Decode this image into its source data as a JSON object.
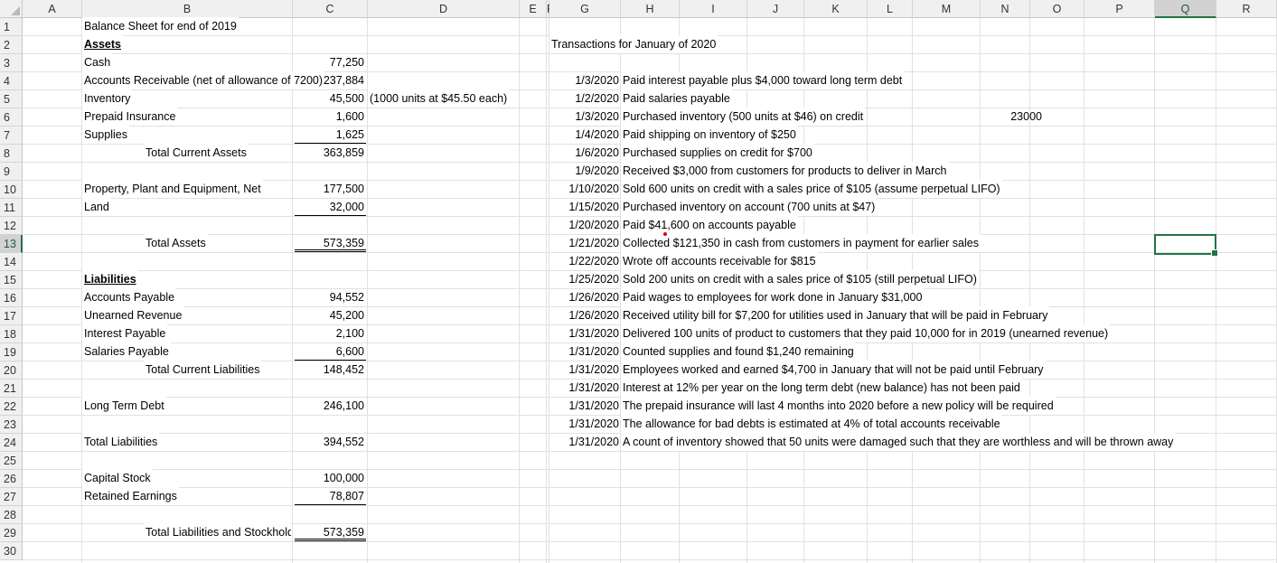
{
  "columns": [
    "A",
    "B",
    "C",
    "D",
    "E",
    "F",
    "G",
    "H",
    "I",
    "J",
    "K",
    "L",
    "M",
    "N",
    "O",
    "P",
    "Q",
    "R"
  ],
  "rows": [
    "1",
    "2",
    "3",
    "4",
    "5",
    "6",
    "7",
    "8",
    "9",
    "10",
    "11",
    "12",
    "13",
    "14",
    "15",
    "16",
    "17",
    "18",
    "19",
    "20",
    "21",
    "22",
    "23",
    "24",
    "25",
    "26",
    "27",
    "28",
    "29",
    "30"
  ],
  "balance": {
    "title": "Balance Sheet for end of 2019",
    "assets_header": "Assets",
    "cash_label": "Cash",
    "cash_value": "77,250",
    "ar_label": "Accounts Receivable (net of allowance of 7200)",
    "ar_value": "237,884",
    "inventory_label": "Inventory",
    "inventory_value": "45,500",
    "inventory_note": "(1000 units at $45.50 each)",
    "prepaid_label": "Prepaid Insurance",
    "prepaid_value": "1,600",
    "supplies_label": "Supplies",
    "supplies_value": "1,625",
    "tca_label": "Total Current Assets",
    "tca_value": "363,859",
    "ppe_label": "Property, Plant and Equipment, Net",
    "ppe_value": "177,500",
    "land_label": "Land",
    "land_value": "32,000",
    "ta_label": "Total Assets",
    "ta_value": "573,359",
    "liabilities_header": "Liabilities",
    "ap_label": "Accounts Payable",
    "ap_value": "94,552",
    "unearned_label": "Unearned Revenue",
    "unearned_value": "45,200",
    "interest_label": "Interest Payable",
    "interest_value": "2,100",
    "salaries_label": "Salaries Payable",
    "salaries_value": "6,600",
    "tcl_label": "Total Current Liabilities",
    "tcl_value": "148,452",
    "ltd_label": "Long Term Debt",
    "ltd_value": "246,100",
    "tl_label": "Total Liabilities",
    "tl_value": "394,552",
    "capital_label": "Capital Stock",
    "capital_value": "100,000",
    "re_label": "Retained Earnings",
    "re_value": "78,807",
    "tlse_label": "Total Liabilities and Stockholders Equi",
    "tlse_value": "573,359"
  },
  "transactions_title": "Transactions for January of 2020",
  "extra_value": "23000",
  "transactions": [
    {
      "date": "1/3/2020",
      "text": "Paid interest payable plus $4,000 toward long term debt"
    },
    {
      "date": "1/2/2020",
      "text": "Paid salaries payable"
    },
    {
      "date": "1/3/2020",
      "text": "Purchased inventory (500 units at $46) on credit"
    },
    {
      "date": "1/4/2020",
      "text": "Paid shipping on inventory of $250"
    },
    {
      "date": "1/6/2020",
      "text": "Purchased supplies on credit for $700"
    },
    {
      "date": "1/9/2020",
      "text": "Received $3,000 from customers for products to deliver in March"
    },
    {
      "date": "1/10/2020",
      "text": "Sold 600 units on credit with a sales price of $105 (assume perpetual LIFO)"
    },
    {
      "date": "1/15/2020",
      "text": "Purchased inventory on account (700 units at $47)"
    },
    {
      "date": "1/20/2020",
      "text": "Paid $41,600 on accounts payable"
    },
    {
      "date": "1/21/2020",
      "text": "Collected $121,350 in cash from customers in payment for earlier sales"
    },
    {
      "date": "1/22/2020",
      "text": "Wrote off accounts receivable for $815"
    },
    {
      "date": "1/25/2020",
      "text": "Sold 200 units on credit with a sales price of $105 (still perpetual LIFO)"
    },
    {
      "date": "1/26/2020",
      "text": "Paid wages to employees for work done in January $31,000"
    },
    {
      "date": "1/26/2020",
      "text": "Received utility bill for $7,200 for utilities used in January that will be paid in February"
    },
    {
      "date": "1/31/2020",
      "text": "Delivered 100 units of product to customers that they paid 10,000 for in 2019 (unearned revenue)"
    },
    {
      "date": "1/31/2020",
      "text": "Counted supplies and found $1,240 remaining"
    },
    {
      "date": "1/31/2020",
      "text": "Employees worked and earned $4,700 in January that will not be paid until February"
    },
    {
      "date": "1/31/2020",
      "text": "Interest at 12% per year on the long term debt (new balance) has not been paid"
    },
    {
      "date": "1/31/2020",
      "text": "The prepaid insurance will last 4 months into 2020 before a new policy will be required"
    },
    {
      "date": "1/31/2020",
      "text": "The allowance for bad debts is estimated at 4% of total accounts receivable"
    },
    {
      "date": "1/31/2020",
      "text": "A count of inventory showed that 50 units were damaged such that they are worthless and will be thrown away"
    }
  ]
}
